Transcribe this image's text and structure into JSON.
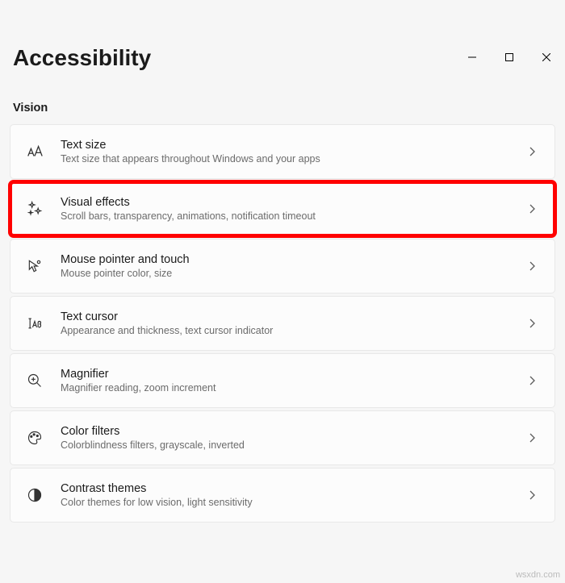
{
  "header": {
    "title": "Accessibility"
  },
  "section": {
    "label": "Vision"
  },
  "items": [
    {
      "id": "text-size",
      "title": "Text size",
      "desc": "Text size that appears throughout Windows and your apps"
    },
    {
      "id": "visual-effects",
      "title": "Visual effects",
      "desc": "Scroll bars, transparency, animations, notification timeout"
    },
    {
      "id": "mouse-pointer-touch",
      "title": "Mouse pointer and touch",
      "desc": "Mouse pointer color, size"
    },
    {
      "id": "text-cursor",
      "title": "Text cursor",
      "desc": "Appearance and thickness, text cursor indicator"
    },
    {
      "id": "magnifier",
      "title": "Magnifier",
      "desc": "Magnifier reading, zoom increment"
    },
    {
      "id": "color-filters",
      "title": "Color filters",
      "desc": "Colorblindness filters, grayscale, inverted"
    },
    {
      "id": "contrast-themes",
      "title": "Contrast themes",
      "desc": "Color themes for low vision, light sensitivity"
    }
  ],
  "watermark": "wsxdn.com"
}
